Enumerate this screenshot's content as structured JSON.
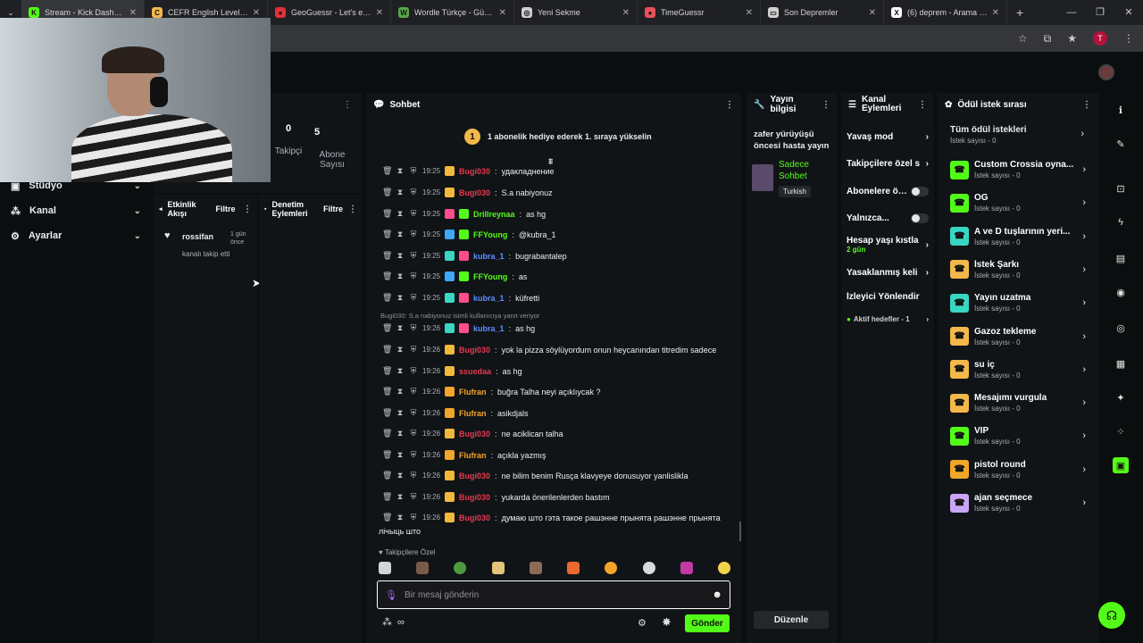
{
  "browser": {
    "tabs": [
      {
        "title": "Stream - Kick Dashboard",
        "icon": "kick-icon",
        "color": "#53fc18",
        "glyph": "K"
      },
      {
        "title": "CEFR English Level Test - ",
        "icon": "cefr-icon",
        "color": "#f2b84b",
        "glyph": "C"
      },
      {
        "title": "GeoGuessr - Let's explore",
        "icon": "geoguessr-icon",
        "color": "#e0303a",
        "glyph": "●"
      },
      {
        "title": "Wordle Türkçe - Günlük K",
        "icon": "wordle-icon",
        "color": "#57a64a",
        "glyph": "W"
      },
      {
        "title": "Yeni Sekme",
        "icon": "chrome-icon",
        "color": "#cfcfcf",
        "glyph": "◎"
      },
      {
        "title": "TimeGuessr",
        "icon": "timeguessr-icon",
        "color": "#e8505b",
        "glyph": "●"
      },
      {
        "title": "Son Depremler",
        "icon": "page-icon",
        "color": "#cfcfcf",
        "glyph": "▭"
      },
      {
        "title": "(6) deprem - Arama / X",
        "icon": "x-icon",
        "color": "#ffffff",
        "glyph": "X"
      }
    ],
    "newtab": "+",
    "profile_initial": "T"
  },
  "sidebar": {
    "items": [
      {
        "label": "Stüdyo",
        "icon": "studio-icon"
      },
      {
        "label": "Kanal",
        "icon": "channel-icon"
      },
      {
        "label": "Ayarlar",
        "icon": "settings-icon"
      }
    ]
  },
  "stats": [
    {
      "value": "0",
      "label": "Takipçi"
    },
    {
      "value": "5",
      "label": "Abone Sayısı"
    }
  ],
  "activity": {
    "title": "Etkinlik Akışı",
    "filter": "Filtre",
    "event_user": "rossifan",
    "event_time": "1 gün önce",
    "event_text": "kanalı takip etti"
  },
  "moderation": {
    "title": "Denetim Eylemleri",
    "filter": "Filtre"
  },
  "chat": {
    "title": "Sohbet",
    "pinned_rank": "1",
    "pinned": "1 abonelik hediye ederek 1. sıraya yükselin",
    "reply_note": "Bugi030: S.a nabiyonuz isimli kullanıcıya yanıt veriyor",
    "messages": [
      {
        "time": "19:25",
        "user": "Bugi030",
        "color": "#e8384f",
        "badges": [
          "#f2b83b"
        ],
        "text": "удакладнение"
      },
      {
        "time": "19:25",
        "user": "Bugi030",
        "color": "#e8384f",
        "badges": [
          "#f2b83b"
        ],
        "text": "S.a nabiyonuz"
      },
      {
        "time": "19:25",
        "user": "Drillreynaa",
        "color": "#53fc18",
        "badges": [
          "#ff4d8d",
          "#53fc18"
        ],
        "text": "as hg"
      },
      {
        "time": "19:25",
        "user": "FFYoung",
        "color": "#53fc18",
        "badges": [
          "#3da9fc",
          "#53fc18"
        ],
        "text": "@kubra_1"
      },
      {
        "time": "19:25",
        "user": "kubra_1",
        "color": "#5b8cff",
        "badges": [
          "#3ad6c4",
          "#ff4d8d"
        ],
        "text": "bugrabantalep"
      },
      {
        "time": "19:25",
        "user": "FFYoung",
        "color": "#53fc18",
        "badges": [
          "#3da9fc",
          "#53fc18"
        ],
        "text": "as"
      },
      {
        "time": "19:25",
        "user": "kubra_1",
        "color": "#5b8cff",
        "badges": [
          "#3ad6c4",
          "#ff4d8d"
        ],
        "text": "küfretti"
      },
      {
        "time": "19:26",
        "user": "kubra_1",
        "color": "#5b8cff",
        "badges": [
          "#3ad6c4",
          "#ff4d8d"
        ],
        "text": "as hg"
      },
      {
        "time": "19:26",
        "user": "Bugi030",
        "color": "#e8384f",
        "badges": [
          "#f2b83b"
        ],
        "text": "yok la pizza söylüyordum onun heycanından titredim sadece"
      },
      {
        "time": "19:26",
        "user": "ssuedaa",
        "color": "#e8384f",
        "badges": [
          "#f2b83b"
        ],
        "text": "as hg"
      },
      {
        "time": "19:26",
        "user": "Flufran",
        "color": "#f2a52b",
        "badges": [
          "#f2a52b"
        ],
        "text": "buğra Talha neyi açıklıycak ?"
      },
      {
        "time": "19:26",
        "user": "Flufran",
        "color": "#f2a52b",
        "badges": [
          "#f2a52b"
        ],
        "text": "asikdjals"
      },
      {
        "time": "19:26",
        "user": "Bugi030",
        "color": "#e8384f",
        "badges": [
          "#f2b83b"
        ],
        "text": "ne aciklican talha"
      },
      {
        "time": "19:26",
        "user": "Flufran",
        "color": "#f2a52b",
        "badges": [
          "#f2a52b"
        ],
        "text": "açıkla yazmış"
      },
      {
        "time": "19:26",
        "user": "Bugi030",
        "color": "#e8384f",
        "badges": [
          "#f2b83b"
        ],
        "text": "ne bilim benim Rusça klavyeye donusuyor yanlislikla"
      },
      {
        "time": "19:26",
        "user": "Bugi030",
        "color": "#e8384f",
        "badges": [
          "#f2b83b"
        ],
        "text": "yukarda önerilenlerden bastım"
      },
      {
        "time": "19:26",
        "user": "Bugi030",
        "color": "#e8384f",
        "badges": [
          "#f2b83b"
        ],
        "text": "думаю што гэта такое рашэнне прынята рашэнне прынята"
      }
    ],
    "last_line_wrap": "лічыць што",
    "followers_only": "Takipçilere Özel",
    "placeholder": "Bir mesaj gönderin",
    "send": "Gönder",
    "infinity": "∞"
  },
  "stream_info": {
    "title": "Yayın bilgisi",
    "stream_title": "zafer yürüyüşü öncesi hasta yayın",
    "chat_mode": "Sadece Sohbet",
    "language": "Turkish",
    "edit": "Düzenle"
  },
  "channel_actions": {
    "title": "Kanal Eylemleri",
    "items": [
      {
        "label": "Yavaş mod",
        "kind": "chevron"
      },
      {
        "label": "Takipçilere özel s",
        "kind": "chevron"
      },
      {
        "label": "Abonelere öz...",
        "kind": "toggle"
      },
      {
        "label": "Yalnızca...",
        "kind": "toggle"
      },
      {
        "label": "Hesap yaşı kıstla",
        "kind": "chevron",
        "sub": "2 gün"
      },
      {
        "label": "Yasaklanmış keli",
        "kind": "chevron"
      },
      {
        "label": "İzleyici Yönlendir",
        "kind": "none"
      },
      {
        "label": "Aktif hedefler - 1",
        "kind": "chevron"
      }
    ]
  },
  "rewards": {
    "title": "Ödül istek sırası",
    "all_title": "Tüm ödül istekleri",
    "all_sub": "İstek sayısı - 0",
    "items": [
      {
        "name": "Custom Crossia oyna...",
        "sub": "İstek sayısı - 0",
        "color": "#53fc18"
      },
      {
        "name": "OG",
        "sub": "İstek sayısı - 0",
        "color": "#53fc18"
      },
      {
        "name": "A ve D tuşlarının yeri...",
        "sub": "İstek sayısı - 0",
        "color": "#3ad6c4"
      },
      {
        "name": "İstek Şarkı",
        "sub": "İstek sayısı - 0",
        "color": "#f2b84b"
      },
      {
        "name": "Yayın uzatma",
        "sub": "İstek sayısı - 0",
        "color": "#3ad6c4"
      },
      {
        "name": "Gazoz tekleme",
        "sub": "İstek sayısı - 0",
        "color": "#f2b84b"
      },
      {
        "name": "su iç",
        "sub": "İstek sayısı - 0",
        "color": "#f2b84b"
      },
      {
        "name": "Mesajımı vurgula",
        "sub": "İstek sayısı - 0",
        "color": "#f2b84b"
      },
      {
        "name": "VIP",
        "sub": "İstek sayısı - 0",
        "color": "#53fc18"
      },
      {
        "name": "pistol round",
        "sub": "İstek sayısı - 0",
        "color": "#f2a52b"
      },
      {
        "name": "ajan seçmece",
        "sub": "İstek sayısı - 0",
        "color": "#c9a6f5"
      }
    ]
  },
  "colors": {
    "accent": "#53fc18",
    "panel": "#111417",
    "bg": "#0b0e0f"
  }
}
